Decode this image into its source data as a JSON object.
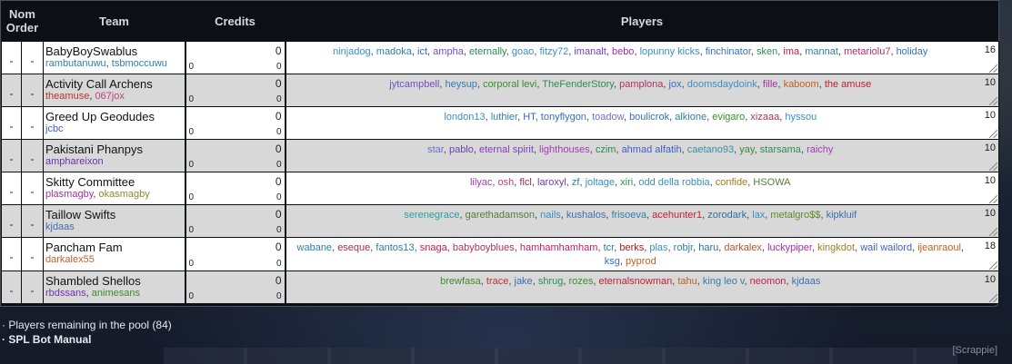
{
  "header": {
    "nom": "Nom",
    "order": "Order",
    "team": "Team",
    "credits": "Credits",
    "players": "Players"
  },
  "rows": [
    {
      "nom": "-",
      "order": "-",
      "team": "BabyBoySwablus",
      "coaches": [
        {
          "name": "rambutanuwu",
          "color": "#2f7fa8"
        },
        {
          "name": "tsbmoccuwu",
          "color": "#2f7fa8"
        }
      ],
      "credits_top": "0",
      "credits_left": "0",
      "credits_bot": "0",
      "count": "16",
      "players": [
        {
          "name": "ninjadog",
          "color": "#3a8fbf"
        },
        {
          "name": "madoka",
          "color": "#2f7fa8"
        },
        {
          "name": "ict",
          "color": "#4060c8"
        },
        {
          "name": "ampha",
          "color": "#7050c0"
        },
        {
          "name": "eternally",
          "color": "#2e8b57"
        },
        {
          "name": "goao",
          "color": "#3a8fbf"
        },
        {
          "name": "fitzy72",
          "color": "#3a8fbf"
        },
        {
          "name": "imanalt",
          "color": "#6a3fb0"
        },
        {
          "name": "bebo",
          "color": "#a030a0"
        },
        {
          "name": "lopunny kicks",
          "color": "#3a8fbf"
        },
        {
          "name": "finchinator",
          "color": "#3a6fb8"
        },
        {
          "name": "sken",
          "color": "#2e8b57"
        },
        {
          "name": "ima",
          "color": "#c02050"
        },
        {
          "name": "mannat",
          "color": "#2f7fa8"
        },
        {
          "name": "metariolu7",
          "color": "#b03060"
        },
        {
          "name": "holiday",
          "color": "#3a6fb8"
        }
      ]
    },
    {
      "nom": "-",
      "order": "-",
      "team": "Activity Call Archens",
      "coaches": [
        {
          "name": "theamuse",
          "color": "#c03030"
        },
        {
          "name": "067jox",
          "color": "#c04080"
        }
      ],
      "credits_top": "0",
      "credits_left": "0",
      "credits_bot": "0",
      "count": "10",
      "players": [
        {
          "name": "jytcampbell",
          "color": "#7050c0"
        },
        {
          "name": "heysup",
          "color": "#2f7fa8"
        },
        {
          "name": "corporal levi",
          "color": "#3d8b2e"
        },
        {
          "name": "TheFenderStory",
          "color": "#2e8b57"
        },
        {
          "name": "pamplona",
          "color": "#b03060"
        },
        {
          "name": "jox",
          "color": "#3a6fb8"
        },
        {
          "name": "doomsdaydoink",
          "color": "#3a8fbf"
        },
        {
          "name": "fille",
          "color": "#a030a0"
        },
        {
          "name": "kaboom",
          "color": "#c06020"
        },
        {
          "name": "the amuse",
          "color": "#c02030"
        }
      ]
    },
    {
      "nom": "-",
      "order": "-",
      "team": "Greed Up Geodudes",
      "coaches": [
        {
          "name": "jcbc",
          "color": "#4060c8"
        }
      ],
      "credits_top": "0",
      "credits_left": "0",
      "credits_bot": "0",
      "count": "10",
      "players": [
        {
          "name": "london13",
          "color": "#3a8fbf"
        },
        {
          "name": "luthier",
          "color": "#2f7fa8"
        },
        {
          "name": "HT",
          "color": "#4060c8"
        },
        {
          "name": "tonyflygon",
          "color": "#3a6fb8"
        },
        {
          "name": "toadow",
          "color": "#6a70c8"
        },
        {
          "name": "boulicrok",
          "color": "#3a6fb8"
        },
        {
          "name": "alkione",
          "color": "#2f7fa8"
        },
        {
          "name": "evigaro",
          "color": "#3d8b2e"
        },
        {
          "name": "xizaaa",
          "color": "#b03060"
        },
        {
          "name": "hyssou",
          "color": "#3a8fbf"
        }
      ]
    },
    {
      "nom": "-",
      "order": "-",
      "team": "Pakistani Phanpys",
      "coaches": [
        {
          "name": "amphareixon",
          "color": "#7030b0"
        }
      ],
      "credits_top": "0",
      "credits_left": "0",
      "credits_bot": "0",
      "count": "10",
      "players": [
        {
          "name": "star",
          "color": "#6a70c8"
        },
        {
          "name": "pablo",
          "color": "#6a3fb0"
        },
        {
          "name": "eternal spirit",
          "color": "#8040c0"
        },
        {
          "name": "lighthouses",
          "color": "#a040b0"
        },
        {
          "name": "czim",
          "color": "#2e8b57"
        },
        {
          "name": "ahmad alfatih",
          "color": "#4060c8"
        },
        {
          "name": "caetano93",
          "color": "#3a8f9f"
        },
        {
          "name": "yay",
          "color": "#3d8b2e"
        },
        {
          "name": "starsama",
          "color": "#2e8b57"
        },
        {
          "name": "raichy",
          "color": "#a040b0"
        }
      ]
    },
    {
      "nom": "-",
      "order": "-",
      "team": "Skitty Committee",
      "coaches": [
        {
          "name": "plasmagby",
          "color": "#a030a0"
        },
        {
          "name": "okasmagby",
          "color": "#8a8a2e"
        }
      ],
      "credits_top": "0",
      "credits_left": "0",
      "credits_bot": "0",
      "count": "10",
      "players": [
        {
          "name": "lilyac",
          "color": "#a040b0"
        },
        {
          "name": "osh",
          "color": "#c04080"
        },
        {
          "name": "flcl",
          "color": "#a03050"
        },
        {
          "name": "laroxyl",
          "color": "#6a3fb0"
        },
        {
          "name": "zf",
          "color": "#2f7fa8"
        },
        {
          "name": "joltage",
          "color": "#3a8fbf"
        },
        {
          "name": "xiri",
          "color": "#2e8b57"
        },
        {
          "name": "odd della robbia",
          "color": "#3a8fbf"
        },
        {
          "name": "confide",
          "color": "#a08020"
        },
        {
          "name": "HSOWA",
          "color": "#5a7a3a"
        }
      ]
    },
    {
      "nom": "-",
      "order": "-",
      "team": "Taillow Swifts",
      "coaches": [
        {
          "name": "kjdaas",
          "color": "#3a6fb8"
        }
      ],
      "credits_top": "0",
      "credits_left": "0",
      "credits_bot": "0",
      "count": "10",
      "players": [
        {
          "name": "serenegrace",
          "color": "#2aa0a0"
        },
        {
          "name": "garethadamson",
          "color": "#5a7a3a"
        },
        {
          "name": "nails",
          "color": "#3a8fbf"
        },
        {
          "name": "kushalos",
          "color": "#3a6fb8"
        },
        {
          "name": "frisoeva",
          "color": "#2f7fa8"
        },
        {
          "name": "acehunter1",
          "color": "#c02030"
        },
        {
          "name": "zorodark",
          "color": "#2f6fa0"
        },
        {
          "name": "lax",
          "color": "#3a8fbf"
        },
        {
          "name": "metalgro$$",
          "color": "#5a8a2e"
        },
        {
          "name": "kipkluif",
          "color": "#3a6fb8"
        }
      ]
    },
    {
      "nom": "-",
      "order": "-",
      "team": "Pancham Fam",
      "coaches": [
        {
          "name": "darkalex55",
          "color": "#c06030"
        }
      ],
      "credits_top": "0",
      "credits_left": "0",
      "credits_bot": "0",
      "count": "18",
      "players": [
        {
          "name": "wabane",
          "color": "#2f7fa8"
        },
        {
          "name": "eseque",
          "color": "#a03050"
        },
        {
          "name": "fantos13",
          "color": "#2f7fa8"
        },
        {
          "name": "snaga",
          "color": "#c02050"
        },
        {
          "name": "babyboyblues",
          "color": "#b03060"
        },
        {
          "name": "hamhamhamham",
          "color": "#c02060"
        },
        {
          "name": "tcr",
          "color": "#3a6fb8"
        },
        {
          "name": "berks",
          "color": "#a02020"
        },
        {
          "name": "plas",
          "color": "#3a8fbf"
        },
        {
          "name": "robjr",
          "color": "#2f7fa8"
        },
        {
          "name": "haru",
          "color": "#2f6fa0"
        },
        {
          "name": "darkalex",
          "color": "#c05030"
        },
        {
          "name": "luckypiper",
          "color": "#a030a0"
        },
        {
          "name": "kingkdot",
          "color": "#a08020"
        },
        {
          "name": "wail wailord",
          "color": "#4060c8"
        },
        {
          "name": "ijeanraoul",
          "color": "#c06020"
        },
        {
          "name": "ksg",
          "color": "#3a6fb8"
        },
        {
          "name": "pyprod",
          "color": "#c06020"
        }
      ]
    },
    {
      "nom": "-",
      "order": "-",
      "team": "Shambled Shellos",
      "coaches": [
        {
          "name": "rbdssans",
          "color": "#7030b0"
        },
        {
          "name": "animesans",
          "color": "#3d8b2e"
        }
      ],
      "credits_top": "0",
      "credits_left": "0",
      "credits_bot": "0",
      "count": "10",
      "players": [
        {
          "name": "brewfasa",
          "color": "#3d8b2e"
        },
        {
          "name": "trace",
          "color": "#c03030"
        },
        {
          "name": "jake",
          "color": "#3a6fb8"
        },
        {
          "name": "shrug",
          "color": "#2e8b57"
        },
        {
          "name": "rozes",
          "color": "#3d8b2e"
        },
        {
          "name": "eternalsnowman",
          "color": "#c02030"
        },
        {
          "name": "tahu",
          "color": "#c06020"
        },
        {
          "name": "king leo v",
          "color": "#2f7fa8"
        },
        {
          "name": "neomon",
          "color": "#c02050"
        },
        {
          "name": "kjdaas",
          "color": "#3a6fb8"
        }
      ]
    }
  ],
  "links": {
    "pool": "· Players remaining in the pool (84)",
    "manual": "· SPL Bot Manual"
  },
  "footer": {
    "scrappie": "[Scrappie]"
  }
}
